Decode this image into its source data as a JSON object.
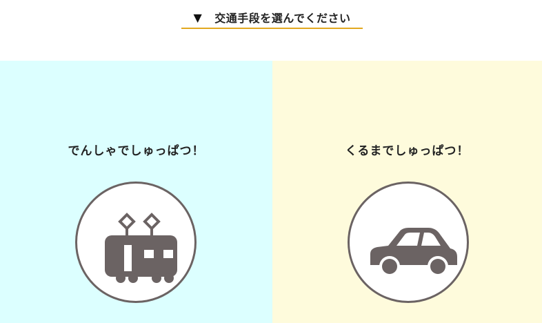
{
  "header": {
    "marker": "▼",
    "title": "交通手段を選んでください",
    "underline_color": "#e2a81f"
  },
  "options": {
    "train": {
      "label": "でんしゃでしゅっぱつ！",
      "icon": "train-icon",
      "background": "#dcffff"
    },
    "car": {
      "label": "くるまでしゅっぱつ！",
      "icon": "car-icon",
      "background": "#fefbdc"
    }
  },
  "colors": {
    "icon_fill": "#6b6363",
    "text": "#222222"
  }
}
